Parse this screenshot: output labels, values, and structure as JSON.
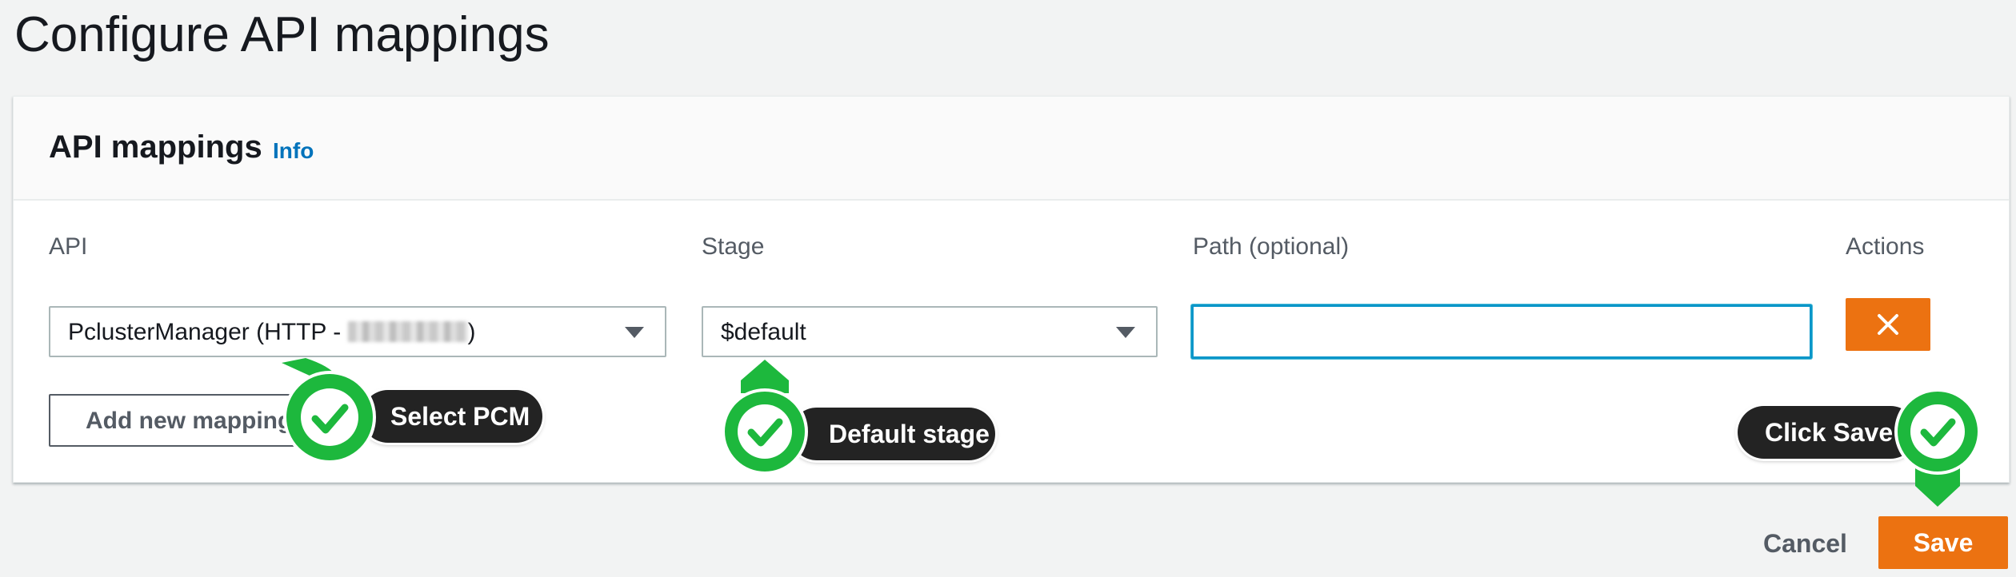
{
  "page": {
    "title": "Configure API mappings"
  },
  "panel": {
    "title": "API mappings",
    "info_label": "Info"
  },
  "columns": {
    "api": "API",
    "stage": "Stage",
    "path": "Path (optional)",
    "actions": "Actions"
  },
  "mapping_row": {
    "api_value_prefix": "PclusterManager (HTTP - ",
    "api_value_suffix": ")",
    "stage_value": "$default",
    "path_value": ""
  },
  "buttons": {
    "add_mapping": "Add new mapping",
    "cancel": "Cancel",
    "save": "Save"
  },
  "annotations": {
    "select_pcm": "Select PCM",
    "default_stage": "Default stage",
    "click_save": "Click Save"
  },
  "colors": {
    "accent_orange": "#ec7211",
    "marker_green": "#1db83d",
    "focus_blue": "#0b96c9",
    "link_blue": "#0073bb"
  },
  "icons": {
    "remove": "close-icon",
    "dropdown": "caret-down-icon",
    "annotation": "check-circle-icon"
  }
}
